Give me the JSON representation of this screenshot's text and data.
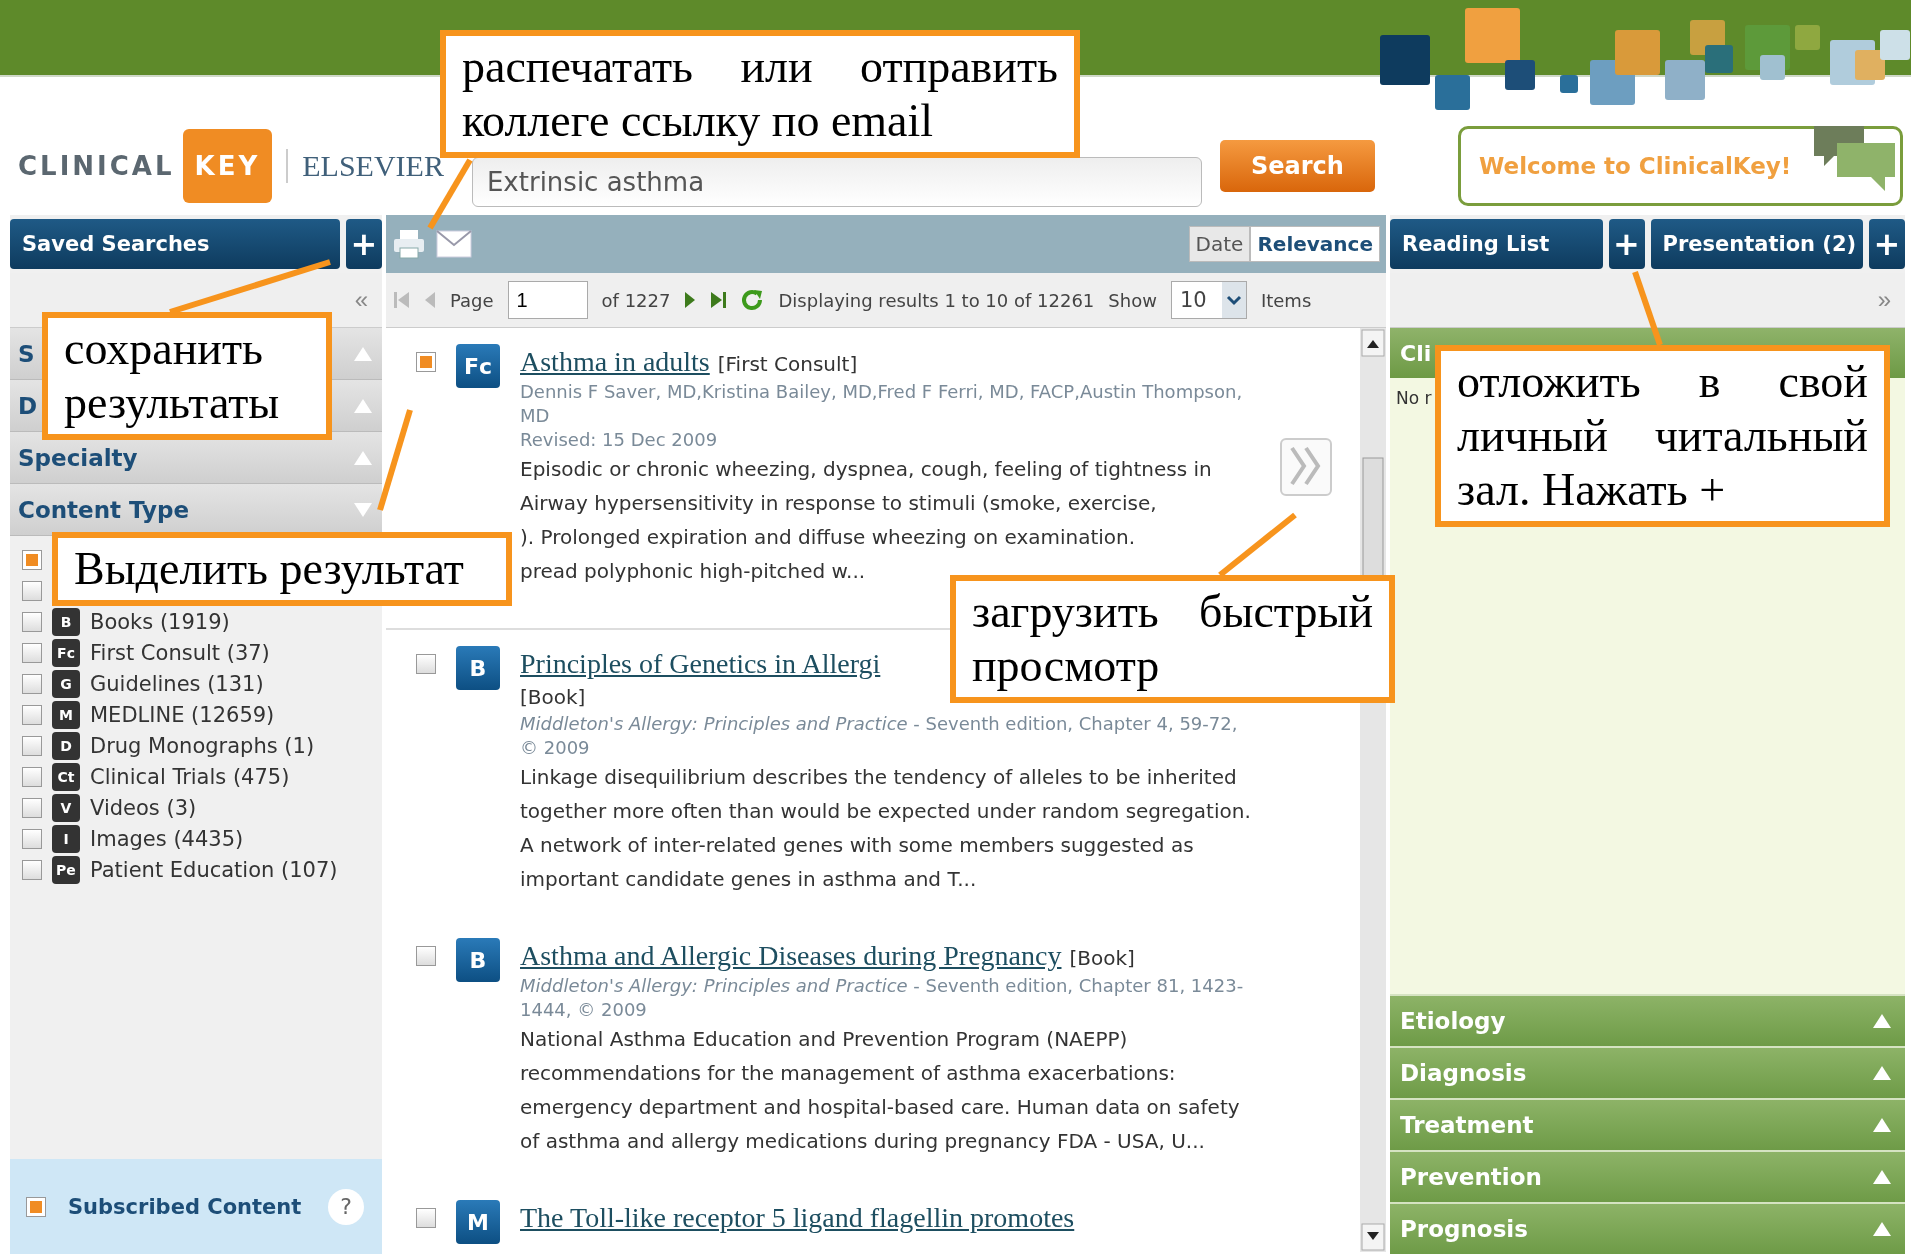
{
  "header": {
    "logo_left": "CLINICAL",
    "logo_right": "KEY",
    "publisher": "ELSEVIER",
    "search": {
      "value": "Extrinsic asthma"
    },
    "search_button": "Search",
    "welcome": "Welcome to ClinicalKey!"
  },
  "left_panel": {
    "title": "Saved Searches",
    "add": "+",
    "collapse": "«",
    "facets": [
      {
        "label": "S",
        "expanded": false
      },
      {
        "label": "D",
        "expanded": false
      },
      {
        "label": "Specialty",
        "expanded": false
      },
      {
        "label": "Content Type",
        "expanded": true
      }
    ],
    "content_types": [
      {
        "checked": true
      },
      {
        "checked": false
      },
      {
        "badge": "B",
        "label": "Books (1919)",
        "checked": false
      },
      {
        "badge": "Fc",
        "label": "First Consult (37)",
        "checked": false
      },
      {
        "badge": "G",
        "label": "Guidelines (131)",
        "checked": false
      },
      {
        "badge": "M",
        "label": "MEDLINE (12659)",
        "checked": false
      },
      {
        "badge": "D",
        "label": "Drug Monographs (1)",
        "checked": false
      },
      {
        "badge": "Ct",
        "label": "Clinical Trials (475)",
        "checked": false
      },
      {
        "badge": "V",
        "label": "Videos (3)",
        "checked": false
      },
      {
        "badge": "I",
        "label": "Images (4435)",
        "checked": false
      },
      {
        "badge": "Pe",
        "label": "Patient Education (107)",
        "checked": false
      }
    ],
    "subscribed": {
      "label": "Subscribed Content",
      "checked": true,
      "help": "?"
    }
  },
  "toolbar": {
    "sort": [
      {
        "label": "Date",
        "selected": false
      },
      {
        "label": "Relevance",
        "selected": true
      }
    ]
  },
  "pager": {
    "page_label": "Page",
    "page": "1",
    "of": "of 1227",
    "displaying": "Displaying results 1 to 10 of 12261",
    "show_label": "Show",
    "show": "10",
    "items": "Items"
  },
  "results": [
    {
      "checked": true,
      "badge": "Fc",
      "title": "Asthma in adults",
      "type": "[First Consult]",
      "authors": "Dennis F Saver, MD,Kristina Bailey, MD,Fred F Ferri, MD, FACP,Austin Thompson, MD",
      "revised": "Revised: 15 Dec 2009",
      "quick_view": true,
      "abstract_lines": [
        "Episodic or chronic wheezing, dyspnea, cough, feeling of tightness in",
        "Airway hypersensitivity in response to stimuli (smoke, exercise,",
        "). Prolonged expiration and diffuse wheezing on examination.",
        "pread polyphonic high-pitched w..."
      ]
    },
    {
      "checked": false,
      "badge": "B",
      "title": "Principles of Genetics in Allergi",
      "type": "[Book]",
      "source_title": "Middleton's Allergy: Principles and Practice",
      "source": " - Seventh edition, Chapter 4, 59-72, © 2009",
      "quick_view": false,
      "abstract_lines": [
        "Linkage disequilibrium describes the tendency of alleles to be inherited",
        "together more often than would be expected under random segregation.",
        "A network of inter-related genes with some members suggested as",
        "important candidate genes in asthma and T..."
      ]
    },
    {
      "checked": false,
      "badge": "B",
      "title": "Asthma and Allergic Diseases during Pregnancy",
      "type": "[Book]",
      "source_title": "Middleton's Allergy: Principles and Practice",
      "source": " - Seventh edition, Chapter 81, 1423-1444, © 2009",
      "quick_view": false,
      "abstract_lines": [
        "National Asthma Education and Prevention Program (NAEPP)",
        "recommendations for the management of asthma exacerbations:",
        "emergency department and hospital-based care. Human data on safety",
        "of asthma and allergy medications during pregnancy FDA - USA, U..."
      ]
    },
    {
      "checked": false,
      "badge": "M",
      "title": "The Toll-like receptor 5 ligand flagellin promotes",
      "quick_view": false
    }
  ],
  "right_panel": {
    "tabs": [
      {
        "label": "Reading List",
        "add": "+"
      },
      {
        "label": "Presentation (2)",
        "add": "+"
      }
    ],
    "collapse": "»",
    "header": "Cli",
    "note": "No r",
    "sections": [
      {
        "label": "Etiology",
        "expanded": false
      },
      {
        "label": "Diagnosis",
        "expanded": false
      },
      {
        "label": "Treatment",
        "expanded": false
      },
      {
        "label": "Prevention",
        "expanded": false
      },
      {
        "label": "Prognosis",
        "expanded": false
      }
    ]
  },
  "callouts": [
    {
      "text": "распечатать или отправить коллеге ссылку по email"
    },
    {
      "text": "сохранить результаты"
    },
    {
      "text": "Выделить результат"
    },
    {
      "text": "загрузить быстрый просмотр"
    },
    {
      "text": "отложить в свой личный читальный зал. Нажать +"
    }
  ]
}
